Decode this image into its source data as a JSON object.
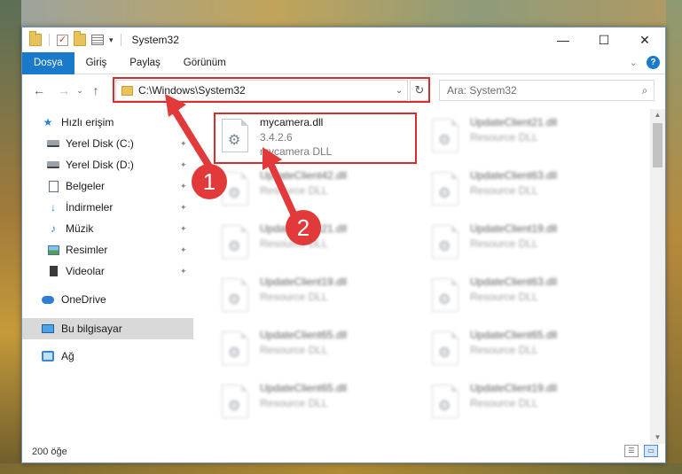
{
  "window": {
    "title": "System32"
  },
  "ribbon": {
    "tabs": [
      "Dosya",
      "Giriş",
      "Paylaş",
      "Görünüm"
    ]
  },
  "address": {
    "path": "C:\\Windows\\System32"
  },
  "search": {
    "placeholder": "Ara: System32"
  },
  "nav": {
    "quick_access": "Hızlı erişim",
    "items": [
      "Yerel Disk (C:)",
      "Yerel Disk (D:)",
      "Belgeler",
      "İndirmeler",
      "Müzik",
      "Resimler",
      "Videolar"
    ],
    "onedrive": "OneDrive",
    "this_pc": "Bu bilgisayar",
    "network": "Ağ"
  },
  "files": {
    "highlighted": {
      "name": "mycamera.dll",
      "version": "3.4.2.6",
      "description": "mycamera DLL"
    },
    "blurred": [
      {
        "name": "UpdateClient21.dll",
        "desc": "Resource DLL"
      },
      {
        "name": "UpdateClient42.dll",
        "desc": "Resource DLL"
      },
      {
        "name": "UpdateClient63.dll",
        "desc": "Resource DLL"
      },
      {
        "name": "UpdateClient21.dll",
        "desc": "Resource DLL"
      },
      {
        "name": "UpdateClient19.dll",
        "desc": "Resource DLL"
      },
      {
        "name": "UpdateClient19.dll",
        "desc": "Resource DLL"
      },
      {
        "name": "UpdateClient63.dll",
        "desc": "Resource DLL"
      },
      {
        "name": "UpdateClient65.dll",
        "desc": "Resource DLL"
      },
      {
        "name": "UpdateClient65.dll",
        "desc": "Resource DLL"
      },
      {
        "name": "UpdateClient65.dll",
        "desc": "Resource DLL"
      },
      {
        "name": "UpdateClient19.dll",
        "desc": "Resource DLL"
      }
    ]
  },
  "status": {
    "count": "200 öğe"
  },
  "annotations": {
    "step1": "1",
    "step2": "2"
  },
  "colors": {
    "accent": "#1979ca",
    "highlight": "#d62d2d",
    "selected": "#d9d9d9"
  },
  "icons": {
    "folder": "folder-icon",
    "refresh": "refresh-icon",
    "search": "search-icon",
    "gear": "gear-icon",
    "star": "star-icon",
    "help": "help-icon"
  }
}
